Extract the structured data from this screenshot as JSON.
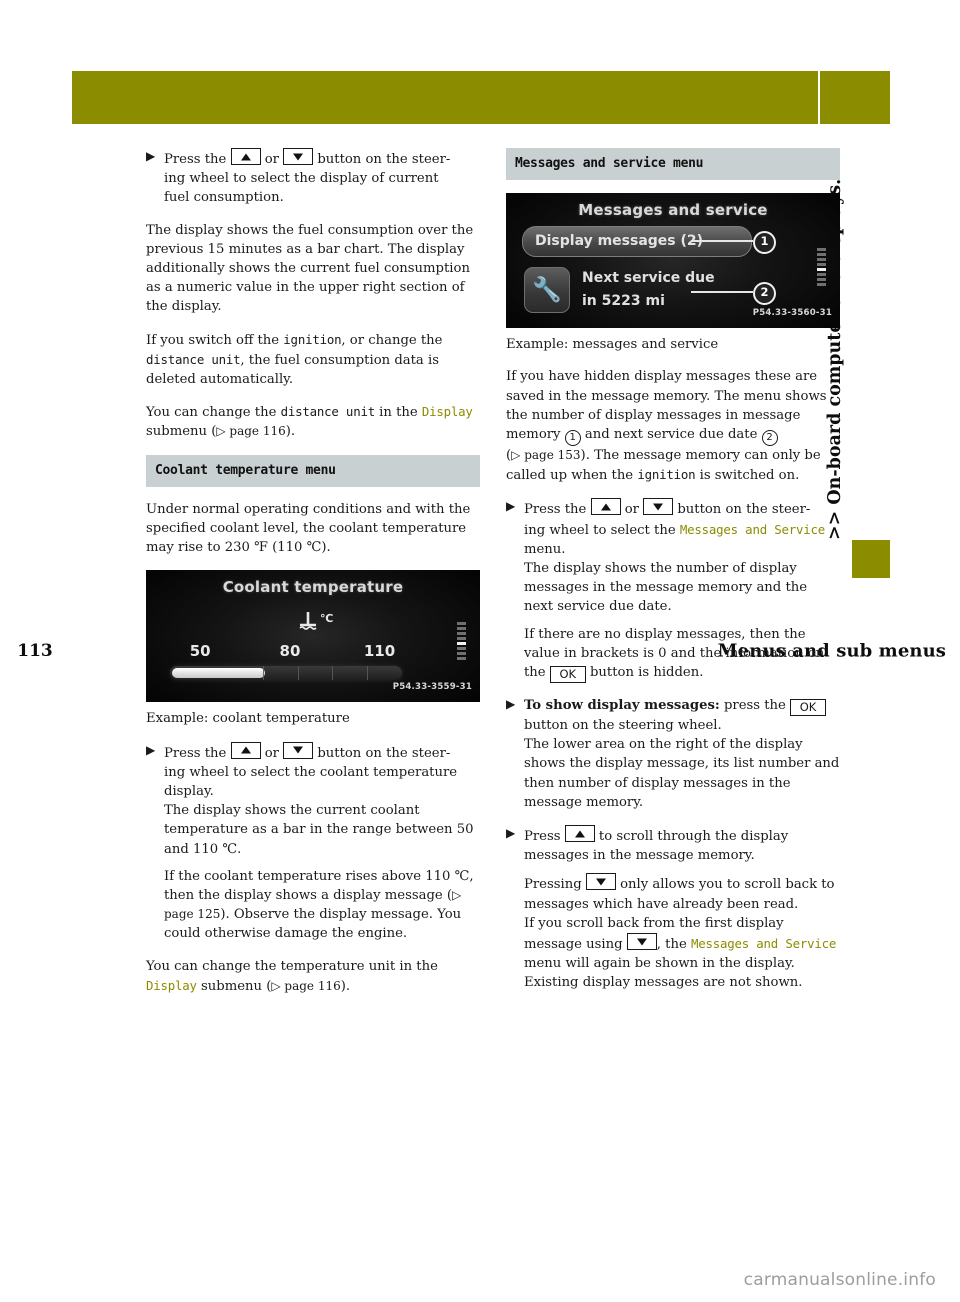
{
  "header": {
    "title": "Menus and sub menus",
    "page_number": "113",
    "band_color": "#8c8c00"
  },
  "side_tab": {
    "chapter_label": ">> On-board computer and displays."
  },
  "watermark": "carmanualsonline.info",
  "left_column": {
    "step_fuel": {
      "bullet": "▶",
      "text_1": "Press the ",
      "or": " or ",
      "text_2": " button on the steer-",
      "line_2": "ing wheel to select the display of current",
      "line_3": "fuel consumption."
    },
    "para_1": "The display shows the fuel consumption over the previous 15 minutes as a bar chart. The display additionally shows the current fuel consumption as a numeric value in the upper right section of the display.",
    "para_2_a": "If you switch off the ",
    "para_2_mono": "ignition",
    "para_2_b": ", or change the ",
    "para_2_mono2": "distance unit",
    "para_2_c": ", the fuel consumption data is deleted automatically.",
    "para_3_a": "You can change the ",
    "para_3_mono": "distance unit",
    "para_3_b": " in the ",
    "para_3_hl": "Display",
    "para_3_c": " submenu (",
    "para_3_ref": "▷ page 116",
    "para_3_d": ").",
    "section_head": "Coolant temperature menu",
    "para_4": "Under normal operating conditions and with the specified coolant level, the coolant temperature may rise to 230 ℉ (110 ℃).",
    "figure_coolant": {
      "title": "Coolant temperature",
      "unit_icon": "℃",
      "scale": [
        "50",
        "80",
        "110"
      ],
      "fill_percent": 40,
      "code": "P54.33-3559-31"
    },
    "caption_coolant": "Example: coolant temperature",
    "step_coolant": {
      "bullet": "▶",
      "text_1": "Press the ",
      "or": " or ",
      "text_2": " button on the steer-",
      "line_2": "ing wheel to select the coolant temperature",
      "line_3": "display.",
      "sub_1": "The display shows the current coolant temperature as a bar in the range between 50 and 110 ℃.",
      "sub_2": "If the coolant temperature rises above 110 ℃, then the display shows a display message (",
      "sub_2_ref": "▷ page 125",
      "sub_2_end": "). Observe the display message. You could otherwise damage the engine."
    },
    "para_5_a": "You can change the temperature unit in the ",
    "para_5_hl": "Display",
    "para_5_b": " submenu (",
    "para_5_ref": "▷ page 116",
    "para_5_c": ")."
  },
  "right_column": {
    "section_head": "Messages and service menu",
    "figure_messages": {
      "title": "Messages and service",
      "row_label": "Display messages (2)",
      "service_line1": "Next service due",
      "service_line2": "in 5223 mi",
      "wrench_icon": "wrench-icon",
      "callout_1": "1",
      "callout_2": "2",
      "code": "P54.33-3560-31"
    },
    "caption_messages": "Example: messages and service",
    "para_1_a": "If you have hidden display messages these are saved in the message memory. The menu shows the number of display messages in message memory ",
    "para_1_c1": "1",
    "para_1_b": " and next service due date ",
    "para_1_c2": "2",
    "para_1_ref_open": "(",
    "para_1_ref": "▷ page 153",
    "para_1_c": "). The message memory can only be called up when the ",
    "para_1_mono": "ignition",
    "para_1_d": " is switched on.",
    "step_messages": {
      "bullet": "▶",
      "text_1": "Press the ",
      "or": " or ",
      "text_2": " button on the steer-",
      "line_2": "ing wheel to select the ",
      "line_2_hl": "Messages and Service",
      "line_2_end": " menu.",
      "sub_1": "The display shows the number of display messages in the message memory and the next service due date.",
      "sub_2_a": "If there are no display messages, then the value in brackets is 0 and the information on the ",
      "sub_2_key": "OK",
      "sub_2_b": " button is hidden."
    },
    "step_show": {
      "bullet": "▶",
      "bold_lead": "To show display messages:",
      "text_1": " press the ",
      "key": "OK",
      "text_2": " button on the steering wheel.",
      "sub_1": "The lower area on the right of the display shows the display message, its list number and then number of display messages in the message memory."
    },
    "step_scroll": {
      "bullet": "▶",
      "text_1": "Press ",
      "text_2": " to scroll through the display messages in the message memory.",
      "sub_1_a": "Pressing ",
      "sub_1_b": " only allows you to scroll back to messages which have already been read.",
      "sub_2_a": "If you scroll back from the first display message using ",
      "sub_2_b": ", the ",
      "sub_2_hl": "Messages and Service",
      "sub_2_c": " menu will again be shown in the display. Existing display messages are not shown."
    }
  }
}
